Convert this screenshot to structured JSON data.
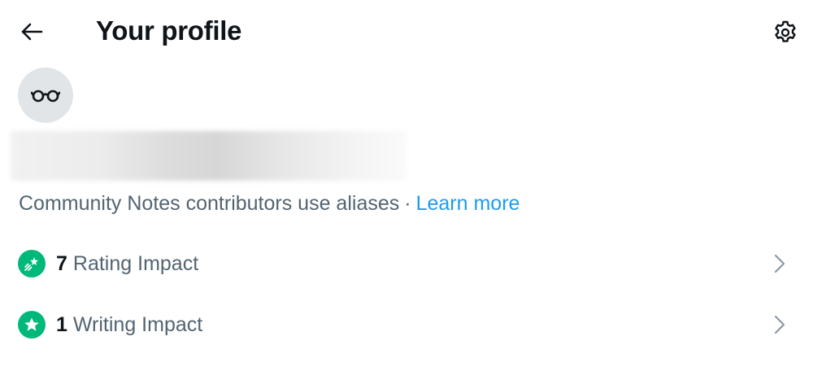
{
  "header": {
    "title": "Your profile",
    "back_icon": "arrow-left-icon",
    "settings_icon": "gear-icon"
  },
  "profile": {
    "avatar_icon": "glasses-icon",
    "alias_note": "Community Notes contributors use aliases",
    "separator": "·",
    "learn_more_label": "Learn more"
  },
  "impacts": [
    {
      "count": "7",
      "label": "Rating Impact",
      "icon": "rating-impact-icon"
    },
    {
      "count": "1",
      "label": "Writing Impact",
      "icon": "star-icon"
    }
  ],
  "colors": {
    "accent": "#1d9bf0",
    "impact_green": "#00b87a",
    "text_primary": "#0f1419",
    "text_secondary": "#536471",
    "avatar_bg": "#e1e5e8"
  }
}
